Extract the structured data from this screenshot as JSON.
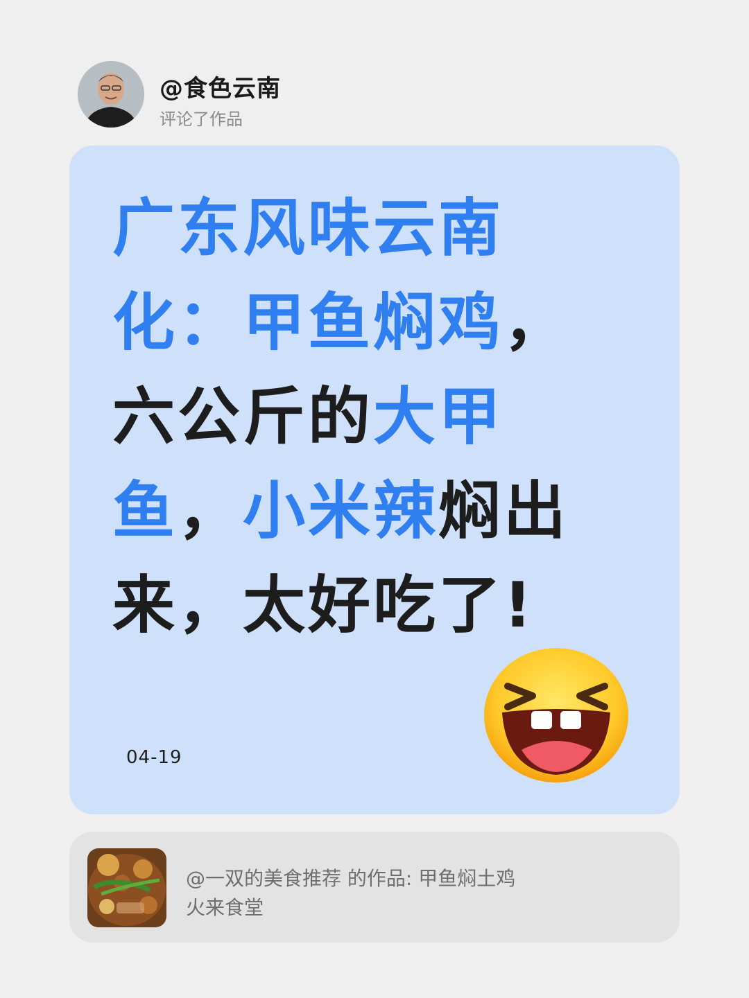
{
  "comment_header": {
    "username": "@食色云南",
    "action": "评论了作品"
  },
  "comment_card": {
    "segments": [
      {
        "text": "广东风味云南化：",
        "highlight": true
      },
      {
        "text": "甲鱼焖鸡",
        "highlight": true
      },
      {
        "text": "，六公斤的",
        "highlight": false
      },
      {
        "text": "大甲鱼",
        "highlight": true
      },
      {
        "text": "，",
        "highlight": false
      },
      {
        "text": "小米辣",
        "highlight": true
      },
      {
        "text": "焖出来，太好吃了!",
        "highlight": false
      }
    ],
    "date": "04-19",
    "reaction_emoji": "laughing-face"
  },
  "referenced_work": {
    "line1": "@一双的美食推荐 的作品: 甲鱼焖土鸡",
    "line2": "火来食堂"
  },
  "colors": {
    "background": "#efefef",
    "card_background": "#cfe0fb",
    "highlight_text": "#2f7ff0",
    "body_text": "#1d1d1d",
    "reference_background": "#e3e3e3"
  }
}
